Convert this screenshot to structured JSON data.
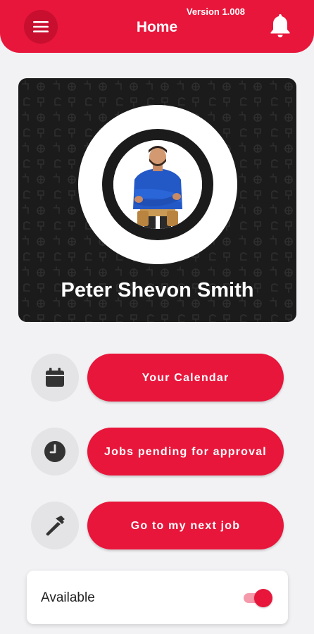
{
  "header": {
    "version": "Version 1.008",
    "title": "Home",
    "menu_icon": "hamburger-icon",
    "bell_icon": "bell-icon"
  },
  "profile": {
    "name": "Peter Shevon Smith"
  },
  "actions": [
    {
      "label": "Your Calendar",
      "icon": "calendar-icon"
    },
    {
      "label": "Jobs pending for approval",
      "icon": "clock-icon"
    },
    {
      "label": "Go to my next job",
      "icon": "hammer-icon"
    }
  ],
  "availability": {
    "label": "Available",
    "enabled": true
  },
  "colors": {
    "brand": "#e8163b",
    "background": "#f2f2f4",
    "card_dark": "#1b1b1b"
  }
}
